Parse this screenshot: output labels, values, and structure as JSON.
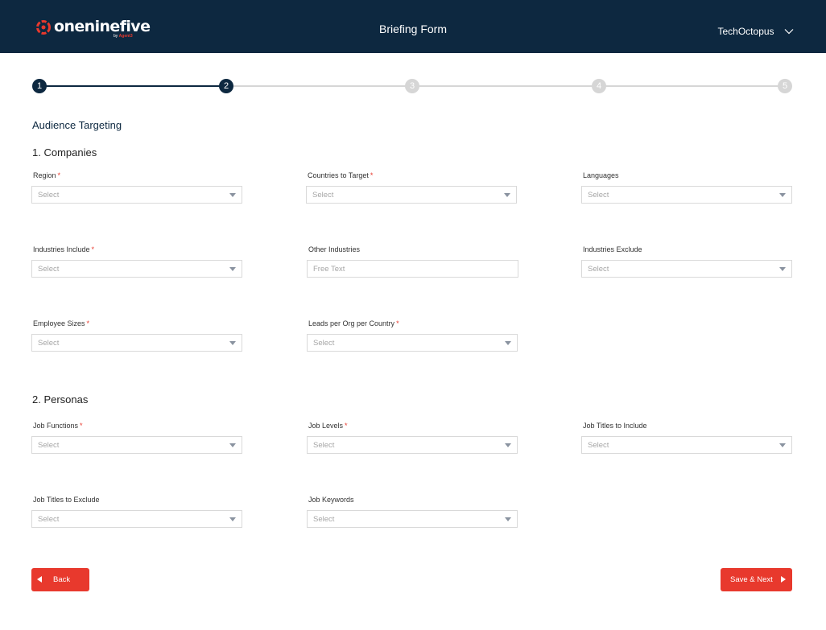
{
  "header": {
    "logo_text": "oneninefive",
    "logo_sub_prefix": "by",
    "logo_sub_brand": "Agent3",
    "title": "Briefing Form",
    "user": "TechOctopus"
  },
  "stepper": {
    "steps": [
      "1",
      "2",
      "3",
      "4",
      "5"
    ],
    "current_step": 2
  },
  "page": {
    "section_title": "Audience Targeting",
    "companies_heading": "1. Companies",
    "personas_heading": "2. Personas"
  },
  "fields": {
    "region": {
      "label": "Region",
      "required": "*",
      "value": "Select"
    },
    "countries": {
      "label": "Countries to Target",
      "required": "*",
      "value": "Select"
    },
    "languages": {
      "label": "Languages",
      "value": "Select"
    },
    "industries_include": {
      "label": "Industries Include",
      "required": "*",
      "value": "Select"
    },
    "other_industries": {
      "label": "Other Industries",
      "placeholder": "Free Text",
      "value": ""
    },
    "industries_exclude": {
      "label": "Industries Exclude",
      "value": "Select"
    },
    "employee_sizes": {
      "label": "Employee Sizes",
      "required": "*",
      "value": "Select"
    },
    "leads_per_org": {
      "label": "Leads per Org per Country",
      "required": "*",
      "value": "Select"
    },
    "job_functions": {
      "label": "Job Functions",
      "required": "*",
      "value": "Select"
    },
    "job_levels": {
      "label": "Job Levels",
      "required": "*",
      "value": "Select"
    },
    "job_titles_include": {
      "label": "Job Titles to Include",
      "value": "Select"
    },
    "job_titles_exclude": {
      "label": "Job Titles to Exclude",
      "value": "Select"
    },
    "job_keywords": {
      "label": "Job Keywords",
      "value": "Select"
    }
  },
  "actions": {
    "back_label": "Back",
    "next_label": "Save & Next"
  },
  "colors": {
    "header_bg": "#0d2840",
    "accent": "#e8392d",
    "step_active": "#0d2840",
    "step_inactive": "#d6d6d6",
    "caret": "#8a93a0"
  }
}
